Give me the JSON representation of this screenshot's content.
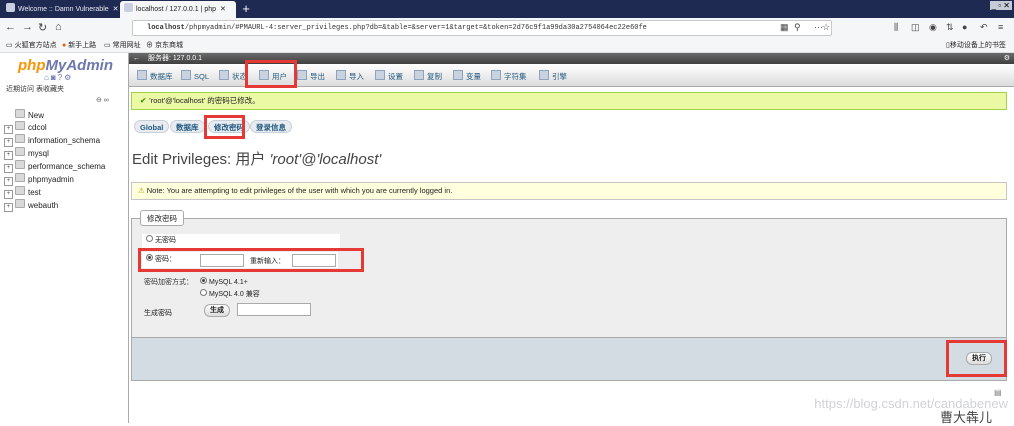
{
  "browser": {
    "tabs": [
      {
        "title": "Welcome :: Damn Vulnerable"
      },
      {
        "title": "localhost / 127.0.0.1 | php"
      }
    ],
    "new_tab": "+",
    "url_host": "localhost",
    "url_rest": "/phpmyadmin/#PMAURL-4:server_privileges.php?db=&table=&server=1&target=&token=2d76c9f1a99da30a2754064ec22e60fe",
    "bookmarks": [
      "火狐官方站点",
      "新手上路",
      "常用网址",
      "京东商城"
    ],
    "mobile_bookmarks": "移动设备上的书签",
    "window_controls": "_ ▫ ✕"
  },
  "sidebar": {
    "logo_php": "php",
    "logo_rest": "MyAdmin",
    "recent": "近期访问",
    "favorites": "表收藏夹",
    "new_label": "New",
    "databases": [
      "cdcol",
      "information_schema",
      "mysql",
      "performance_schema",
      "phpmyadmin",
      "test",
      "webauth"
    ]
  },
  "main": {
    "server_label": "服务器: 127.0.0.1",
    "menu": [
      "数据库",
      "SQL",
      "状态",
      "用户",
      "导出",
      "导入",
      "设置",
      "复制",
      "变量",
      "字符集",
      "引擎"
    ],
    "success_message": "'root'@'localhost' 的密码已修改。",
    "subtabs": [
      "Global",
      "数据库",
      "修改密码",
      "登录信息"
    ],
    "heading_prefix": "Edit Privileges: 用户",
    "heading_user": "'root'@'localhost'",
    "note": "Note: You are attempting to edit privileges of the user with which you are currently logged in.",
    "legend": "修改密码",
    "no_password": "无密码",
    "password_label": "密码：",
    "reenter_label": "重新输入：",
    "hashing_label": "密码加密方式：",
    "hash_options": [
      "MySQL 4.1+",
      "MySQL 4.0 兼容"
    ],
    "generate_label": "生成密码",
    "generate_button": "生成",
    "execute_button": "执行"
  },
  "watermark": "https://blog.csdn.net/candabenew",
  "signature": "曹大犇儿",
  "colors": {
    "highlight": "#e53935",
    "success_bg": "#ebf8a4",
    "link": "#235a81"
  }
}
